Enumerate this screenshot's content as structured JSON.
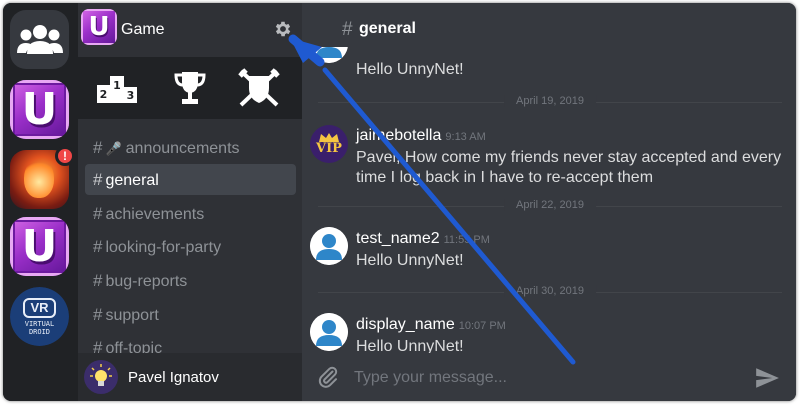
{
  "server_rail": {
    "servers": [
      {
        "name": "friends",
        "icon": "users-icon"
      },
      {
        "name": "unnynet-game",
        "letter": "U"
      },
      {
        "name": "hero-game",
        "badge": "!"
      },
      {
        "name": "unnynet-game-2",
        "letter": "U"
      },
      {
        "name": "virtual-droid",
        "vr_label": "VR",
        "vr_text_1": "VIRTUAL",
        "vr_text_2": "DROID"
      }
    ]
  },
  "guild": {
    "name": "Game",
    "icon_letter": "U",
    "actions": [
      {
        "name": "leaderboard",
        "icon": "podium-icon"
      },
      {
        "name": "achievements",
        "icon": "trophy-icon"
      },
      {
        "name": "guilds",
        "icon": "shield-swords-icon"
      }
    ]
  },
  "channels": [
    {
      "label": "announcements",
      "icon": "microphone-icon",
      "active": false
    },
    {
      "label": "general",
      "active": true
    },
    {
      "label": "achievements",
      "active": false
    },
    {
      "label": "looking-for-party",
      "active": false
    },
    {
      "label": "bug-reports",
      "active": false
    },
    {
      "label": "support",
      "active": false
    },
    {
      "label": "off-topic",
      "active": false
    }
  ],
  "channel_hash": "#",
  "user": {
    "name": "Pavel Ignatov",
    "avatar": "lightbulb-icon"
  },
  "chat": {
    "channel_name": "general",
    "messages": [
      {
        "text": "Hello UnnyNet!"
      },
      {
        "divider": "April 19, 2019"
      },
      {
        "author": "jaimebotella",
        "time": "9:13 AM",
        "avatar_text": "VIP",
        "text": "Pavel, How come my friends never stay accepted and every time I log back in I have to re-accept them"
      },
      {
        "divider": "April 22, 2019"
      },
      {
        "author": "test_name2",
        "time": "11:55 PM",
        "text": "Hello UnnyNet!"
      },
      {
        "divider": "April 30, 2019"
      },
      {
        "author": "display_name",
        "time": "10:07 PM",
        "text": "Hello UnnyNet!"
      }
    ],
    "input_placeholder": "Type your message..."
  },
  "colors": {
    "arrow": "#1f5ad1",
    "accent_active": "#42464d",
    "badge": "#f04747"
  }
}
